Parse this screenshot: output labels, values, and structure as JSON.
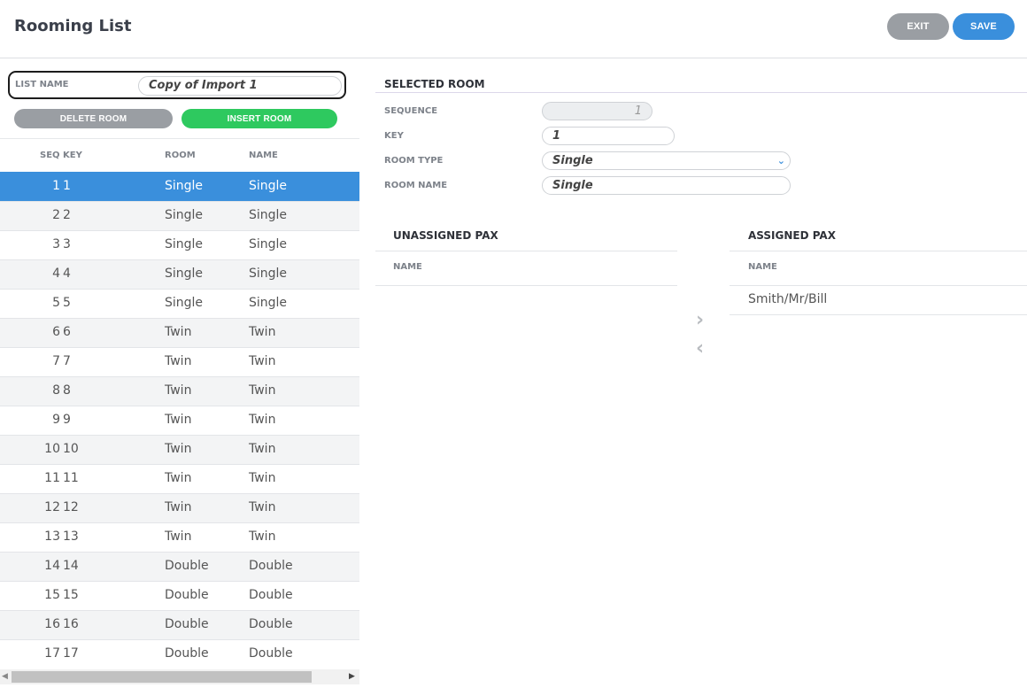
{
  "header": {
    "title": "Rooming List",
    "exit_label": "EXIT",
    "save_label": "SAVE"
  },
  "list": {
    "label": "LIST NAME",
    "value": "Copy of Import 1",
    "delete_label": "DELETE ROOM",
    "insert_label": "INSERT ROOM"
  },
  "table": {
    "columns": {
      "seq": "SEQ",
      "key": "KEY",
      "room": "ROOM",
      "name": "NAME"
    },
    "rows": [
      {
        "seq": "1",
        "key": "1",
        "room": "Single",
        "name": "Single"
      },
      {
        "seq": "2",
        "key": "2",
        "room": "Single",
        "name": "Single"
      },
      {
        "seq": "3",
        "key": "3",
        "room": "Single",
        "name": "Single"
      },
      {
        "seq": "4",
        "key": "4",
        "room": "Single",
        "name": "Single"
      },
      {
        "seq": "5",
        "key": "5",
        "room": "Single",
        "name": "Single"
      },
      {
        "seq": "6",
        "key": "6",
        "room": "Twin",
        "name": "Twin"
      },
      {
        "seq": "7",
        "key": "7",
        "room": "Twin",
        "name": "Twin"
      },
      {
        "seq": "8",
        "key": "8",
        "room": "Twin",
        "name": "Twin"
      },
      {
        "seq": "9",
        "key": "9",
        "room": "Twin",
        "name": "Twin"
      },
      {
        "seq": "10",
        "key": "10",
        "room": "Twin",
        "name": "Twin"
      },
      {
        "seq": "11",
        "key": "11",
        "room": "Twin",
        "name": "Twin"
      },
      {
        "seq": "12",
        "key": "12",
        "room": "Twin",
        "name": "Twin"
      },
      {
        "seq": "13",
        "key": "13",
        "room": "Twin",
        "name": "Twin"
      },
      {
        "seq": "14",
        "key": "14",
        "room": "Double",
        "name": "Double"
      },
      {
        "seq": "15",
        "key": "15",
        "room": "Double",
        "name": "Double"
      },
      {
        "seq": "16",
        "key": "16",
        "room": "Double",
        "name": "Double"
      },
      {
        "seq": "17",
        "key": "17",
        "room": "Double",
        "name": "Double"
      }
    ]
  },
  "selected_room": {
    "title": "SELECTED ROOM",
    "sequence_label": "SEQUENCE",
    "sequence_value": "1",
    "key_label": "KEY",
    "key_value": "1",
    "room_type_label": "ROOM TYPE",
    "room_type_value": "Single",
    "room_name_label": "ROOM NAME",
    "room_name_value": "Single"
  },
  "pax": {
    "unassigned_title": "UNASSIGNED PAX",
    "assigned_title": "ASSIGNED PAX",
    "name_column": "NAME",
    "assigned": [
      "Smith/Mr/Bill"
    ]
  },
  "icons": {
    "move_right": "chevron-right-icon",
    "move_left": "chevron-left-icon",
    "dropdown": "chevron-down-icon"
  },
  "colors": {
    "accent": "#3a8fdc",
    "insert": "#2ec95f",
    "neutral_button": "#9a9ea3"
  }
}
